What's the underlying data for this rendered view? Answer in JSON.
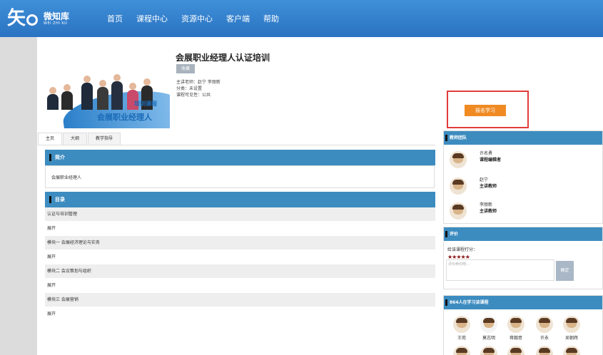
{
  "brand": {
    "logo_glyph": "矢",
    "name": "微知库",
    "name_en": "WEI ZHI KU"
  },
  "nav": [
    "首页",
    "课程中心",
    "资源中心",
    "客户端",
    "帮助"
  ],
  "banner": {
    "subtitle": "培训课程",
    "title": "会展职业经理人"
  },
  "course": {
    "title": "会展职业经理人认证培训",
    "collect_label": "收藏",
    "teachers_line": "主讲老师：赵宁 李丽新",
    "category_line": "分类：未设置",
    "visibility_line": "课程可见性：公共"
  },
  "signup_label": "报名学习",
  "tabs": [
    "主页",
    "大纲",
    "教学指导"
  ],
  "intro": {
    "heading": "简介",
    "text": "会展职业经理人"
  },
  "catalog": {
    "heading": "目录",
    "rows": [
      "认证与培训管理",
      "展开",
      "模块一 会展经济理论与实务",
      "展开",
      "模块二 会议策划与组织",
      "展开",
      "模块三 会展营销",
      "展开"
    ]
  },
  "teacher_team": {
    "heading": "教师团队",
    "members": [
      {
        "name": "许名勇",
        "role": "课程编辑者"
      },
      {
        "name": "赵宁",
        "role": "主讲教师"
      },
      {
        "name": "李丽新",
        "role": "主讲教师"
      }
    ]
  },
  "review": {
    "heading": "评价",
    "rate_label": "给该课程打分：",
    "stars": "★★★★★",
    "placeholder": "评价两句吧...",
    "confirm_label": "确定"
  },
  "learners": {
    "heading": "864人在学习该课程",
    "names": [
      "王苑",
      "莫志明",
      "蒋翰意",
      "许永",
      "吴朝辉"
    ]
  },
  "colors": {
    "nav_blue": "#2f80cf",
    "section_blue": "#3d8cc0",
    "signup_orange": "#f08a23",
    "highlight_red": "#e23c3c"
  }
}
